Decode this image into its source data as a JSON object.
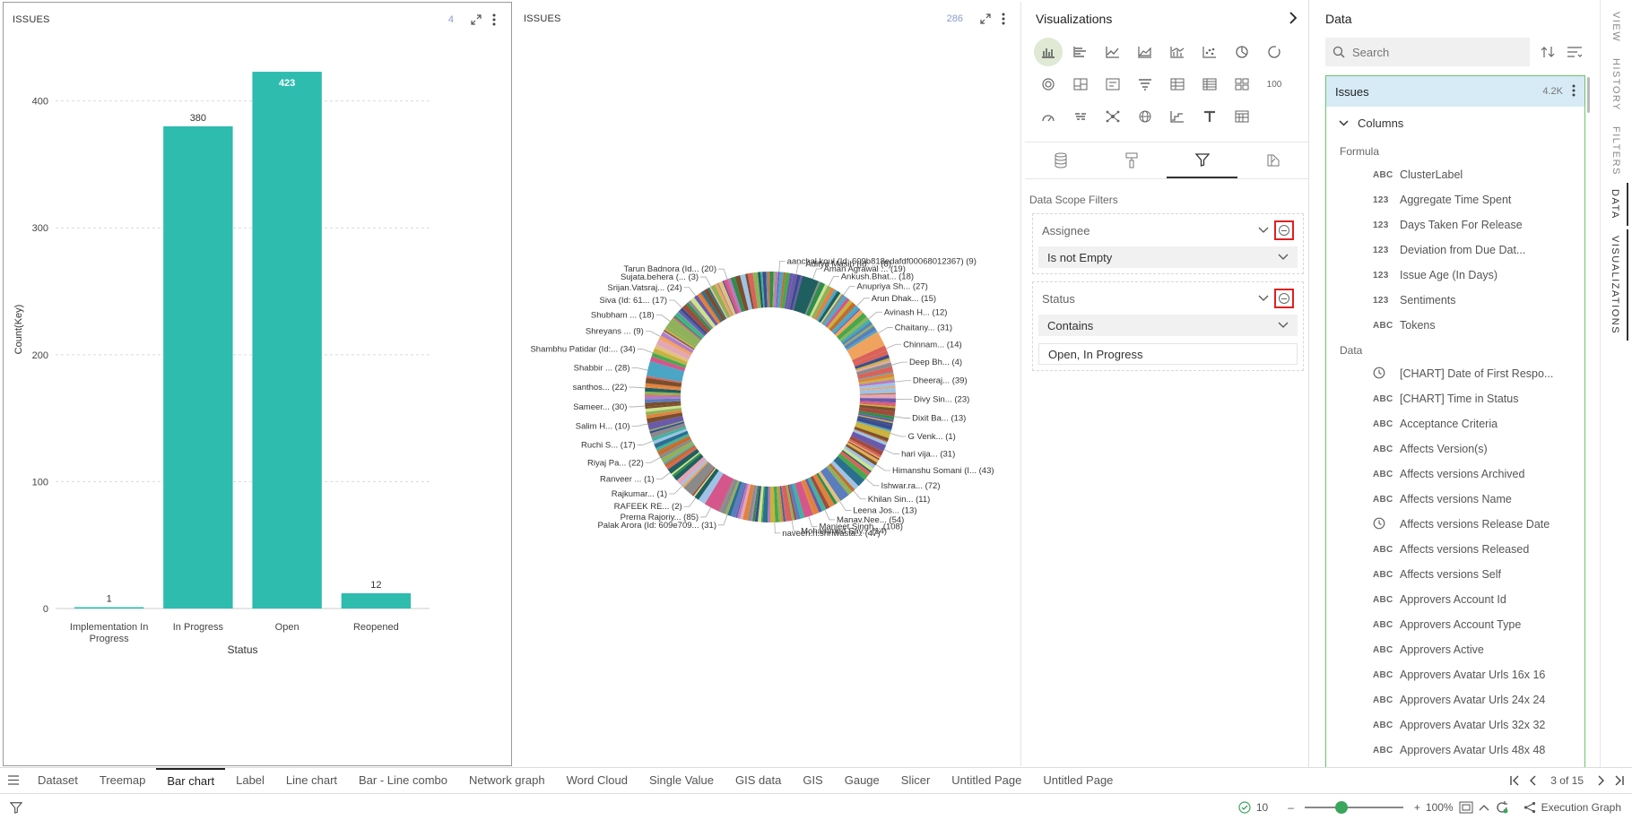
{
  "left_panel": {
    "title": "ISSUES",
    "count": "4"
  },
  "mid_panel": {
    "title": "ISSUES",
    "count": "286"
  },
  "bar_chart": {
    "categories": [
      "Implementation In Progress",
      "In Progress",
      "Open",
      "Reopened"
    ],
    "values": [
      1,
      380,
      423,
      12
    ],
    "ylabel": "Count(Key)",
    "xlabel": "Status",
    "ticks": [
      "0",
      "100",
      "200",
      "300",
      "400"
    ],
    "color": "#2ebcaf"
  },
  "donut_labels": {
    "left": [
      "Tarun Badnora (Id... (20)",
      "Sujata.behera (... (3)",
      "Srijan.Vatsraj... (24)",
      "Siva (Id: 61... (17)",
      "Shubham ... (18)",
      "Shreyans ... (9)",
      "Shambhu Patidar (Id:... (34)",
      "Shabbir ... (28)",
      "santhos... (22)",
      "Sameer... (30)",
      "Salim H... (10)",
      "Ruchi S... (17)",
      "Riyaj Pa... (22)",
      "Ranveer ... (1)",
      "Rajkumar... (1)",
      "RAFEEK RE... (2)",
      "Prerna Rajoriy... (85)",
      "Palak Arora (Id: 609e709... (31)"
    ],
    "right": [
      "aanchal.koul (Id: 609b818edafdf00068012367) (9)",
      "Aditya Masih (Id: ... (8)",
      "Aman Agrawal ... (19)",
      "Ankush.Bhat... (18)",
      "Anupriya Sh... (27)",
      "Arun Dhak... (15)",
      "Avinash H... (12)",
      "Chaitany... (31)",
      "Chinnam... (14)",
      "Deep Bh... (4)",
      "Dheeraj... (39)",
      "Divy Sin... (23)",
      "Dixit Ba... (13)",
      "G Venk... (1)",
      "hari vija... (31)",
      "Himanshu Somani (I... (43)",
      "Ishwar.ra... (72)",
      "Khilan Sin... (11)",
      "Leena Jos... (13)",
      "Manav.Nee... (54)",
      "Manjeet Singh... (108)",
      "Mohammed Say... (14)",
      "naveen.n.shriwasta... (47)"
    ]
  },
  "viz_pane": {
    "title": "Visualizations",
    "data_scope_title": "Data Scope Filters",
    "filters": [
      {
        "field": "Assignee",
        "operator": "Is not Empty",
        "value": ""
      },
      {
        "field": "Status",
        "operator": "Contains",
        "value": "Open, In Progress"
      }
    ],
    "hundred_label": "100"
  },
  "data_pane": {
    "title": "Data",
    "search_placeholder": "Search",
    "dataset": "Issues",
    "dataset_count": "4.2K",
    "columns_label": "Columns",
    "formula_label": "Formula",
    "formula_fields": [
      {
        "type": "ABC",
        "name": "ClusterLabel"
      },
      {
        "type": "123",
        "name": "Aggregate Time Spent"
      },
      {
        "type": "123",
        "name": "Days Taken For Release"
      },
      {
        "type": "123",
        "name": "Deviation from Due Dat..."
      },
      {
        "type": "123",
        "name": "Issue Age (In Days)"
      },
      {
        "type": "123",
        "name": "Sentiments"
      },
      {
        "type": "ABC",
        "name": "Tokens"
      }
    ],
    "data_label": "Data",
    "data_fields": [
      {
        "type": "clock",
        "name": "[CHART] Date of First Respo..."
      },
      {
        "type": "ABC",
        "name": "[CHART] Time in Status"
      },
      {
        "type": "ABC",
        "name": "Acceptance Criteria"
      },
      {
        "type": "ABC",
        "name": "Affects Version(s)"
      },
      {
        "type": "ABC",
        "name": "Affects versions Archived"
      },
      {
        "type": "ABC",
        "name": "Affects versions Name"
      },
      {
        "type": "clock",
        "name": "Affects versions Release Date"
      },
      {
        "type": "ABC",
        "name": "Affects versions Released"
      },
      {
        "type": "ABC",
        "name": "Affects versions Self"
      },
      {
        "type": "ABC",
        "name": "Approvers Account Id"
      },
      {
        "type": "ABC",
        "name": "Approvers Account Type"
      },
      {
        "type": "ABC",
        "name": "Approvers Active"
      },
      {
        "type": "ABC",
        "name": "Approvers Avatar Urls 16x 16"
      },
      {
        "type": "ABC",
        "name": "Approvers Avatar Urls 24x 24"
      },
      {
        "type": "ABC",
        "name": "Approvers Avatar Urls 32x 32"
      },
      {
        "type": "ABC",
        "name": "Approvers Avatar Urls 48x 48"
      }
    ]
  },
  "rail_tabs": [
    "VIEW",
    "HISTORY",
    "FILTERS",
    "DATA",
    "VISUALIZATIONS"
  ],
  "page_tabs": [
    "Dataset",
    "Treemap",
    "Bar chart",
    "Label",
    "Line chart",
    "Bar - Line combo",
    "Network graph",
    "Word Cloud",
    "Single Value",
    "GIS data",
    "GIS",
    "Gauge",
    "Slicer",
    "Untitled Page",
    "Untitled Page"
  ],
  "active_page_tab": "Bar chart",
  "pager": "3 of 15",
  "status": {
    "check_count": "10",
    "zoom": "100%",
    "execution_label": "Execution Graph"
  }
}
